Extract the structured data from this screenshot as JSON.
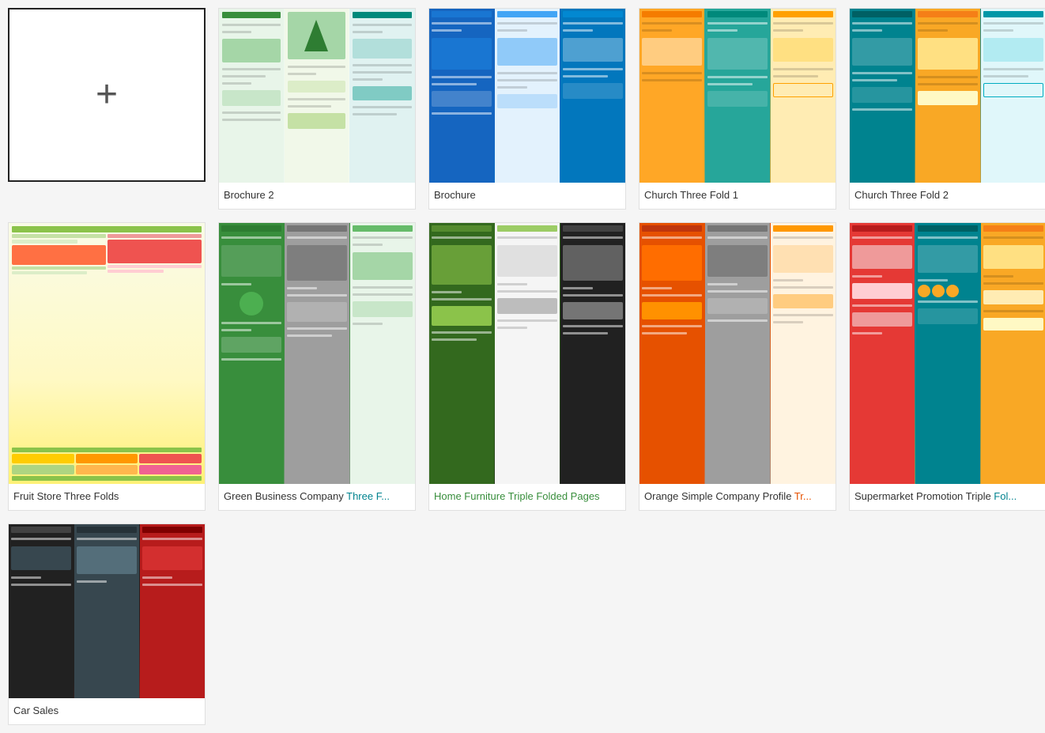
{
  "cards": {
    "blank": {
      "label": "New"
    },
    "row1": [
      {
        "id": "brochure2",
        "label": "Brochure 2",
        "labelParts": [
          {
            "text": "Brochure 2",
            "style": "normal"
          }
        ]
      },
      {
        "id": "brochure",
        "label": "Brochure",
        "labelParts": [
          {
            "text": "Brochure",
            "style": "normal"
          }
        ]
      },
      {
        "id": "church1",
        "label": "Church Three Fold 1",
        "labelParts": [
          {
            "text": "Church Three Fold 1",
            "style": "normal"
          }
        ]
      },
      {
        "id": "church2",
        "label": "Church Three Fold 2",
        "labelParts": [
          {
            "text": "Church Three Fold 2",
            "style": "normal"
          }
        ]
      }
    ],
    "col1_row2": {
      "id": "fruit",
      "label": "Fruit Store Three Folds",
      "labelParts": [
        {
          "text": "Fruit Store Three Folds",
          "style": "normal"
        }
      ]
    },
    "row2": [
      {
        "id": "greenbiz",
        "label": "Green Business Company Three F...",
        "labelParts": [
          {
            "text": "Green Business Company ",
            "style": "normal"
          },
          {
            "text": "Three F...",
            "style": "teal"
          }
        ]
      },
      {
        "id": "furniture",
        "label": "Home Furniture Triple Folded Pages",
        "labelParts": [
          {
            "text": "Home Furniture Triple Folded Pages",
            "style": "green"
          }
        ]
      },
      {
        "id": "orange",
        "label": "Orange Simple Company Profile Tr...",
        "labelParts": [
          {
            "text": "Orange Simple Company Profile ",
            "style": "normal"
          },
          {
            "text": "Tr...",
            "style": "orange"
          }
        ]
      },
      {
        "id": "supermarket",
        "label": "Supermarket Promotion Triple Fol...",
        "labelParts": [
          {
            "text": "Supermarket Promotion Triple ",
            "style": "normal"
          },
          {
            "text": "Fol...",
            "style": "teal"
          }
        ]
      }
    ],
    "col1_row3": {
      "id": "car",
      "label": "Car Sales"
    }
  }
}
